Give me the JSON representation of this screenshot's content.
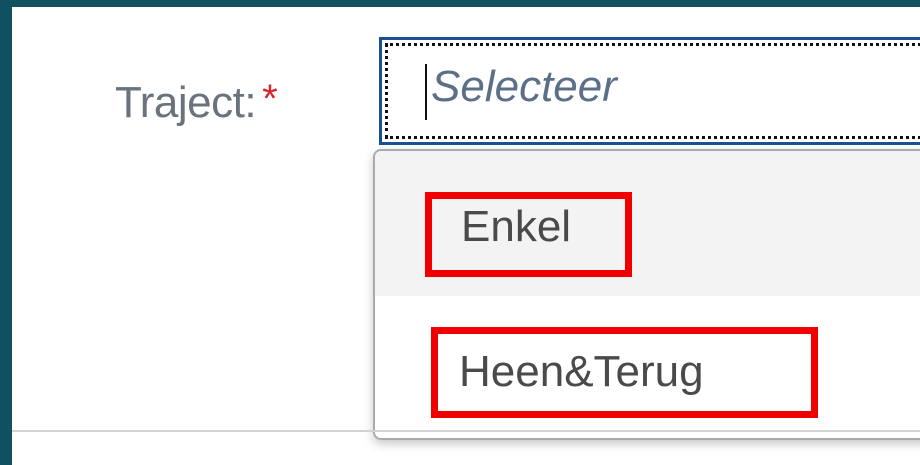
{
  "form": {
    "label": "Traject:",
    "required_marker": "*",
    "select": {
      "placeholder": "Selecteer",
      "is_open": true,
      "options": [
        {
          "label": "Enkel",
          "highlighted": true
        },
        {
          "label": "Heen&Terug",
          "highlighted": true
        }
      ]
    }
  },
  "colors": {
    "frame_border": "#0f5160",
    "focus_border": "#1a4f92",
    "required": "#d6262d",
    "highlight_box": "#f00000"
  }
}
